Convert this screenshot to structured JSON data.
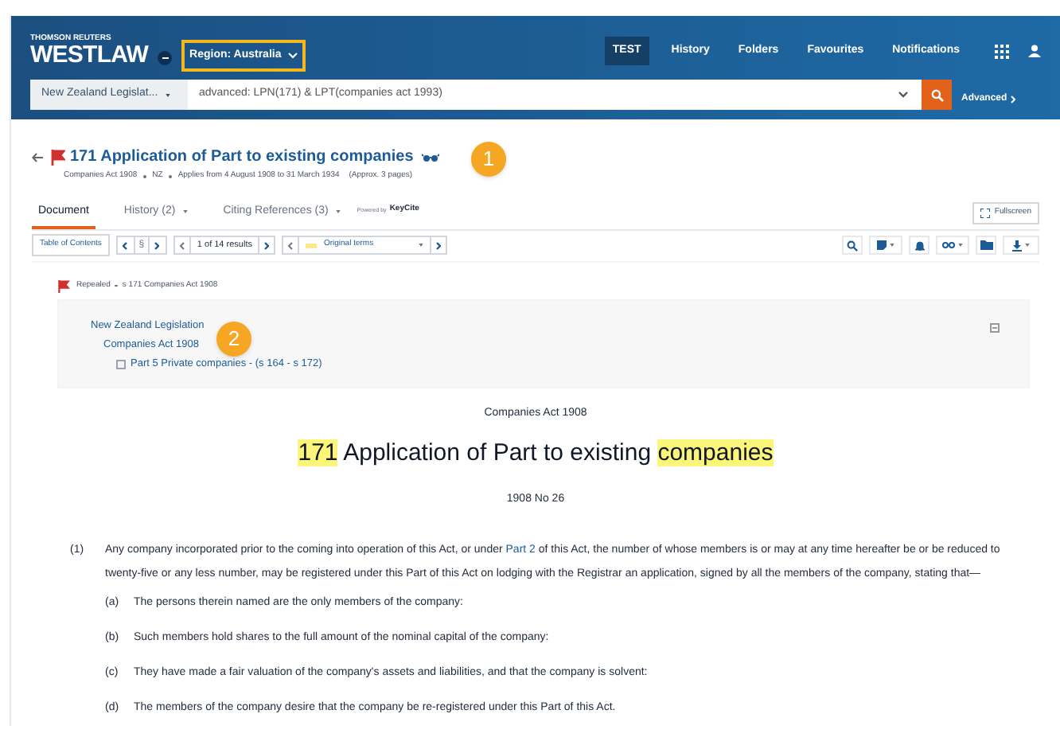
{
  "header": {
    "brand_top": "THOMSON REUTERS",
    "brand": "WESTLAW",
    "region": "Region: Australia",
    "region_highlighted": true,
    "nav": [
      {
        "label": "TEST",
        "selected": true
      },
      {
        "label": "History",
        "selected": false
      },
      {
        "label": "Folders",
        "selected": false
      },
      {
        "label": "Favourites",
        "selected": false
      },
      {
        "label": "Notifications",
        "selected": false
      }
    ],
    "jurisdiction": "New Zealand Legislat...",
    "query": "advanced: LPN(171) & LPT(companies act 1993)",
    "advanced": "Advanced"
  },
  "document": {
    "title": "171 Application of Part to existing companies",
    "meta": [
      "Companies Act 1908",
      "NZ",
      "Applies from 4 August 1908 to 31 March 1934",
      "(Approx. 3 pages)"
    ],
    "tabs": [
      {
        "label": "Document",
        "selected": true,
        "dropdown": false
      },
      {
        "label": "History (2)",
        "selected": false,
        "dropdown": true
      },
      {
        "label": "Citing References (3)",
        "selected": false,
        "dropdown": true
      }
    ],
    "powered_by": "Powered by",
    "keycite": "KeyCite",
    "fullscreen": "Fullscreen",
    "toolbar": {
      "toc": "Table of Contents",
      "section_symbol": "§",
      "results": "1 of 14 results",
      "terms": "Original terms"
    },
    "status": [
      "Repealed",
      "s 171 Companies Act 1908"
    ],
    "breadcrumb": [
      {
        "label": "New Zealand Legislation",
        "children": [
          {
            "label": "Companies Act 1908",
            "children": [
              {
                "label": "Part 5 Private companies - (s 164 - s 172)"
              }
            ]
          }
        ]
      }
    ],
    "act": "Companies Act 1908",
    "heading": [
      {
        "text": "171",
        "highlighted": true
      },
      {
        "text": " Application of Part to existing ",
        "highlighted": false
      },
      {
        "text": "companies",
        "highlighted": true
      }
    ],
    "number": "1908 No 26",
    "paragraphs": [
      {
        "label": "(1)",
        "parts": [
          {
            "text": "Any company incorporated prior to the coming into operation of this Act, or under ",
            "kind": "text"
          },
          {
            "text": "Part 2",
            "kind": "link"
          },
          {
            "text": " of this Act, the number of whose members is or may at any time hereafter be or be reduced to twenty-five or any less number, may be registered under this Part of this Act on lodging with the Registrar an application, signed by all the members of the company, stating that—",
            "kind": "text"
          }
        ],
        "children": [
          {
            "label": "(a)",
            "text": "The persons therein named are the only members of the company:"
          },
          {
            "label": "(b)",
            "text": "Such members hold shares to the full amount of the nominal capital of the company:"
          },
          {
            "label": "(c)",
            "text": "They have made a fair valuation of the company's assets and liabilities, and that the company is solvent:"
          },
          {
            "label": "(d)",
            "text": "The members of the company desire that the company be re-registered under this Part of this Act."
          }
        ]
      }
    ]
  },
  "callouts": [
    "1",
    "2"
  ]
}
